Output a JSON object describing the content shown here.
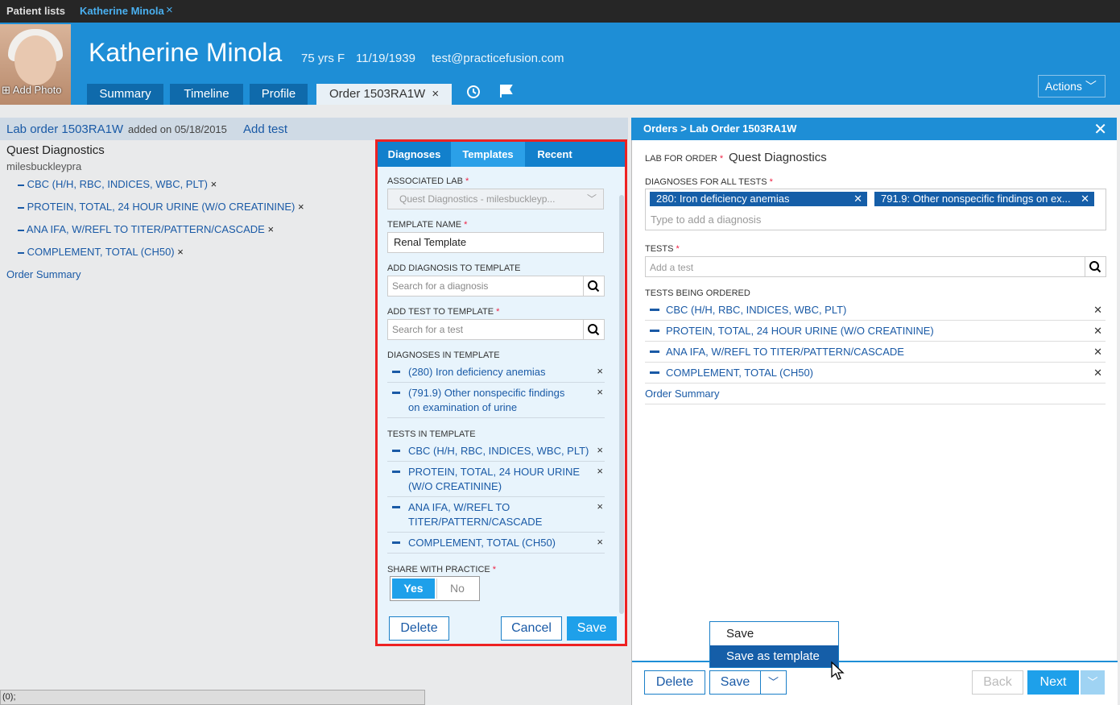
{
  "topbar": {
    "patient_lists": "Patient lists",
    "active_tab": "Katherine Minola",
    "close": "×"
  },
  "patient": {
    "name": "Katherine Minola",
    "age_sex": "75 yrs F",
    "dob": "11/19/1939",
    "email": "test@practicefusion.com",
    "add_photo": "Add Photo"
  },
  "nav_tabs": [
    "Summary",
    "Timeline",
    "Profile",
    "Order 1503RA1W"
  ],
  "nav_close": "×",
  "actions_label": "Actions",
  "left": {
    "order_title": "Lab order 1503RA1W",
    "added_on": "added on 05/18/2015",
    "add_test": "Add test",
    "lab": "Quest Diagnostics",
    "user": "milesbuckleypra",
    "tests": [
      "CBC (H/H, RBC, INDICES, WBC, PLT)",
      "PROTEIN, TOTAL, 24 HOUR URINE (W/O CREATININE)",
      "ANA IFA, W/REFL TO TITER/PATTERN/CASCADE",
      "COMPLEMENT, TOTAL (CH50)"
    ],
    "order_summary": "Order Summary"
  },
  "popup": {
    "tabs": [
      "Diagnoses",
      "Templates",
      "Recent"
    ],
    "associated_lab_label": "ASSOCIATED LAB",
    "associated_lab_value": "Quest Diagnostics - milesbuckleyp...",
    "template_name_label": "TEMPLATE NAME",
    "template_name_value": "Renal Template",
    "add_diag_label": "ADD DIAGNOSIS TO TEMPLATE",
    "add_diag_placeholder": "Search for a diagnosis",
    "add_test_label": "ADD TEST TO TEMPLATE",
    "add_test_placeholder": "Search for a test",
    "diag_in_template_label": "DIAGNOSES IN TEMPLATE",
    "diagnoses": [
      [
        "(280) Iron deficiency anemias"
      ],
      [
        "(791.9) Other nonspecific findings",
        "on examination of urine"
      ]
    ],
    "tests_in_template_label": "TESTS IN TEMPLATE",
    "tests": [
      [
        "CBC (H/H, RBC, INDICES, WBC, PLT)"
      ],
      [
        "PROTEIN, TOTAL, 24 HOUR URINE",
        "(W/O CREATININE)"
      ],
      [
        "ANA IFA, W/REFL TO",
        "TITER/PATTERN/CASCADE"
      ],
      [
        "COMPLEMENT, TOTAL (CH50)"
      ]
    ],
    "share_label": "SHARE WITH PRACTICE",
    "yes": "Yes",
    "no": "No",
    "delete": "Delete",
    "cancel": "Cancel",
    "save": "Save",
    "required": "*",
    "close": "×"
  },
  "right": {
    "title": "Orders > Lab Order 1503RA1W",
    "lab_for_order_label": "LAB FOR ORDER",
    "lab_for_order_value": "Quest Diagnostics",
    "diagnoses_label": "DIAGNOSES FOR ALL TESTS",
    "chips": [
      "280: Iron deficiency anemias",
      "791.9: Other nonspecific findings on ex..."
    ],
    "diag_placeholder": "Type to add a diagnosis",
    "tests_label": "TESTS",
    "tests_placeholder": "Add a test",
    "tests_ordered_label": "TESTS BEING ORDERED",
    "tests": [
      "CBC (H/H, RBC, INDICES, WBC, PLT)",
      "PROTEIN, TOTAL, 24 HOUR URINE (W/O CREATININE)",
      "ANA IFA, W/REFL TO TITER/PATTERN/CASCADE",
      "COMPLEMENT, TOTAL (CH50)"
    ],
    "order_summary": "Order Summary",
    "delete": "Delete",
    "save": "Save",
    "back": "Back",
    "next": "Next"
  },
  "save_menu": [
    "Save",
    "Save as template"
  ],
  "status_bar": "(0);",
  "colors": {
    "accent": "#1e8ed6",
    "dark_tab": "#0f6aab",
    "popup_border": "#e22222"
  }
}
